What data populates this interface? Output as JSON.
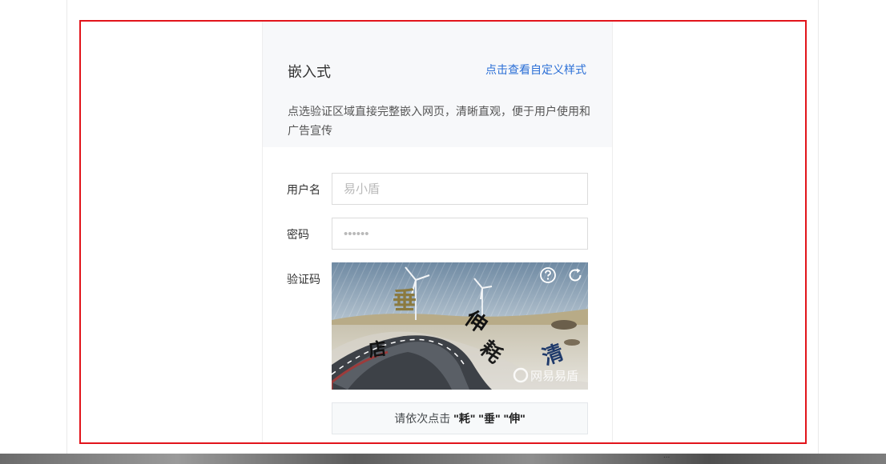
{
  "card": {
    "title": "嵌入式",
    "custom_link": "点击查看自定义样式",
    "description": "点选验证区域直接完整嵌入网页，清晰直观，便于用户使用和广告宣传"
  },
  "form": {
    "username_label": "用户名",
    "username_placeholder": "易小盾",
    "password_label": "密码",
    "password_placeholder": "••••••",
    "captcha_label": "验证码"
  },
  "captcha": {
    "chars": [
      "垂",
      "店",
      "伸",
      "耗",
      "清"
    ],
    "watermark": "网易易盾",
    "hint_prefix": "请依次点击",
    "hint_words": "\"耗\" \"垂\" \"伸\"",
    "icons": [
      "help-icon",
      "refresh-icon"
    ]
  },
  "taskbar": {
    "mark": "..."
  },
  "colors": {
    "highlight": "#e2141b",
    "link": "#2b6fd6",
    "panel": "#f7f8fa"
  }
}
